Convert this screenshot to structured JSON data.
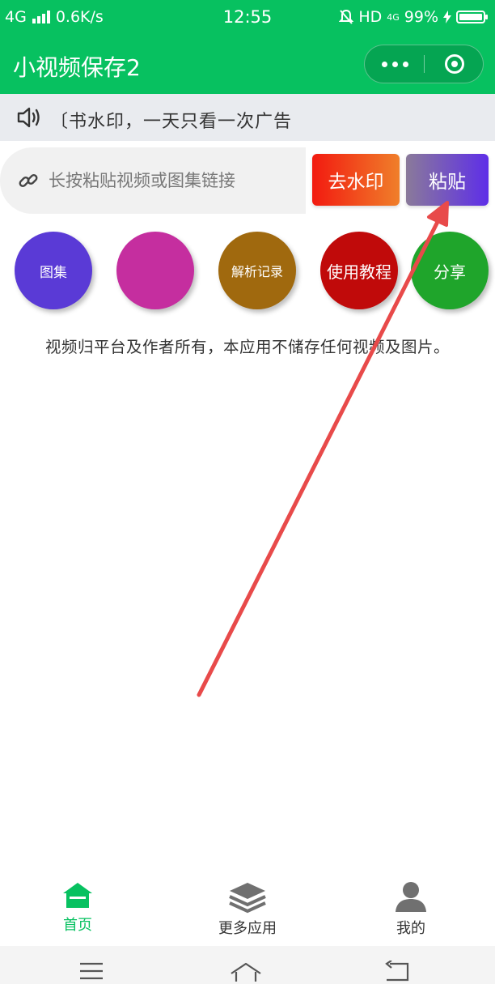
{
  "status_bar": {
    "network": "4G",
    "speed": "0.6K/s",
    "time": "12:55",
    "hd": "HD",
    "network_right": "4G",
    "battery": "99%",
    "battery_level": 0.99
  },
  "app": {
    "title": "小视频保存2",
    "brand_color": "#07c160"
  },
  "notice": {
    "text": "〔书水印，一天只看一次广告"
  },
  "input": {
    "placeholder": "长按粘贴视频或图集链接",
    "value": ""
  },
  "buttons": {
    "remove_watermark": "去水印",
    "paste": "粘贴"
  },
  "shortcuts": [
    {
      "label": "图集",
      "color": "#5a3ad6"
    },
    {
      "label": "",
      "color": "#c52e9f"
    },
    {
      "label": "解析记录",
      "color": "#a0690e"
    },
    {
      "label": "使用教程",
      "color": "#c00a0a"
    },
    {
      "label": "分享",
      "color": "#1fa52b"
    }
  ],
  "disclaimer": "视频归平台及作者所有，本应用不储存任何视频及图片。",
  "tabs": [
    {
      "label": "首页",
      "icon": "home-icon",
      "active": true
    },
    {
      "label": "更多应用",
      "icon": "layers-icon",
      "active": false
    },
    {
      "label": "我的",
      "icon": "user-icon",
      "active": false
    }
  ],
  "annotation_arrow_color": "#e84a4a"
}
